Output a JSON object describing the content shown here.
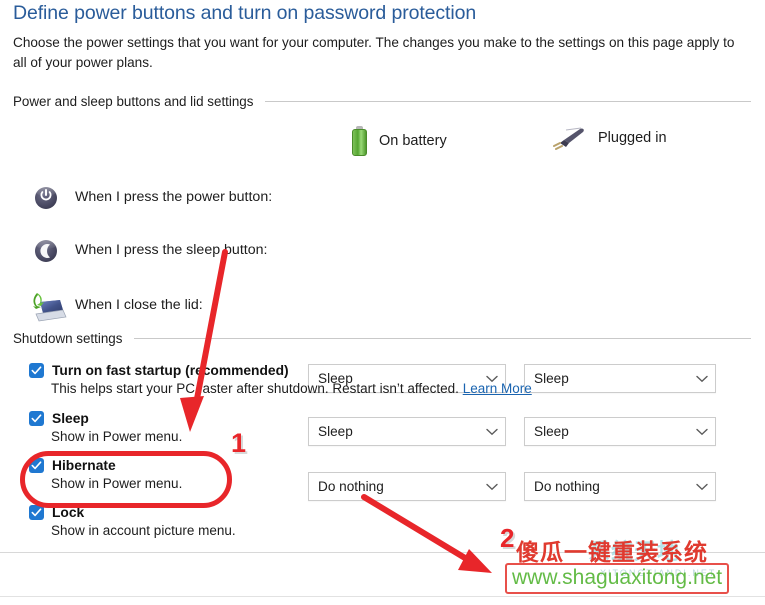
{
  "header": {
    "title": "Define power buttons and turn on password protection",
    "description": "Choose the power settings that you want for your computer. The changes you make to the settings on this page apply to all of your power plans."
  },
  "sections": {
    "power_and_sleep": {
      "label": "Power and sleep buttons and lid settings"
    },
    "shutdown": {
      "label": "Shutdown settings"
    }
  },
  "columns": {
    "battery": {
      "label": "On battery",
      "icon": "battery-icon"
    },
    "plugged": {
      "label": "Plugged in",
      "icon": "power-plug-icon"
    }
  },
  "settings_rows": [
    {
      "icon": "power-button-icon",
      "label": "When I press the power button:",
      "on_battery": "Sleep",
      "plugged_in": "Sleep"
    },
    {
      "icon": "sleep-button-icon",
      "label": "When I press the sleep button:",
      "on_battery": "Sleep",
      "plugged_in": "Sleep"
    },
    {
      "icon": "laptop-lid-icon",
      "label": "When I close the lid:",
      "on_battery": "Do nothing",
      "plugged_in": "Do nothing"
    }
  ],
  "shutdown_items": [
    {
      "title": "Turn on fast startup (recommended)",
      "subtitle": "This helps start your PC faster after shutdown. Restart isn’t affected.",
      "link": "Learn More",
      "checked": true
    },
    {
      "title": "Sleep",
      "subtitle": "Show in Power menu.",
      "link": "",
      "checked": true
    },
    {
      "title": "Hibernate",
      "subtitle": "Show in Power menu.",
      "link": "",
      "checked": true
    },
    {
      "title": "Lock",
      "subtitle": "Show in account picture menu.",
      "link": "",
      "checked": true
    }
  ],
  "annotations": {
    "marker_one": "1",
    "marker_two": "2",
    "highlight_color": "#e8262a"
  },
  "watermark": {
    "chinese_text": "傻瓜一键重装系统",
    "url": "www.shaguaxitong.net",
    "faint_text": "系统天地",
    "faint_sub": "XITONGTIANDI.NET",
    "url_color": "#63bb46",
    "text_color": "#e03a2f"
  }
}
